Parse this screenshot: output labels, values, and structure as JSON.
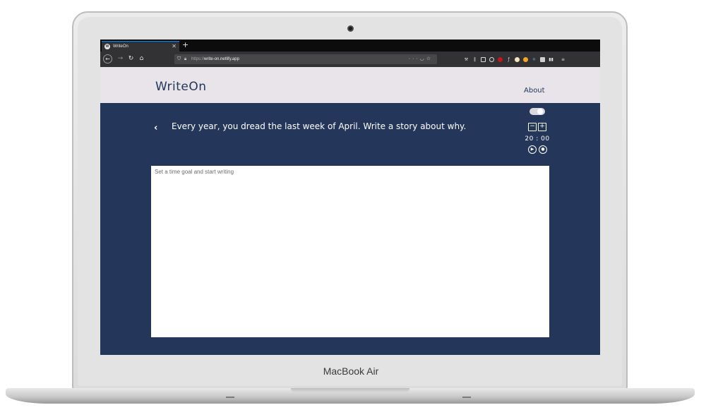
{
  "device": {
    "label": "MacBook Air"
  },
  "browser": {
    "tab_title": "WriteOn",
    "tab_favicon": "W",
    "tab_close_icon": "close-icon",
    "new_tab_icon": "plus-icon",
    "url_scheme": "https://",
    "url_host": "write-on.netlify.app",
    "nav_icons": [
      "back-arrow-icon",
      "forward-arrow-icon",
      "reload-icon",
      "home-icon"
    ],
    "url_actions": [
      "more-icon",
      "pocket-icon",
      "star-icon"
    ],
    "extensions": [
      "wrench-icon",
      "library-icon",
      "sidebar-icon",
      "account-icon",
      "ublock-icon",
      "function-icon",
      "bulb-icon",
      "honey-icon",
      "react-icon",
      "screenshot-icon",
      "barcode-icon",
      "menu-icon"
    ],
    "accent_color": "#0a84ff"
  },
  "app": {
    "logo": "WriteOn",
    "nav": {
      "about": "About"
    },
    "prompt": "Every year, you dread the last week of April. Write a story about why.",
    "timer": {
      "display": "20 : 00",
      "decrease_icon": "minus-square-icon",
      "increase_icon": "plus-square-icon",
      "play_icon": "play-circle-icon",
      "stop_icon": "stop-circle-icon"
    },
    "toggle": {
      "icon": "toggle-switch-icon",
      "state": "on"
    },
    "editor": {
      "placeholder": "Set a time goal and start writing",
      "value": ""
    },
    "colors": {
      "primary": "#243659",
      "header_bg": "#e8e4ea",
      "editor_bg": "#ffffff"
    }
  }
}
